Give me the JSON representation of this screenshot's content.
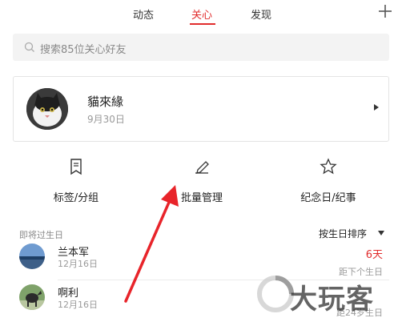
{
  "top_tabs": [
    {
      "label": "动态",
      "active": false
    },
    {
      "label": "关心",
      "active": true
    },
    {
      "label": "发现",
      "active": false
    }
  ],
  "search": {
    "placeholder": "搜索85位关心好友"
  },
  "featured": {
    "name": "貓來緣",
    "date": "9月30日"
  },
  "actions": [
    {
      "label": "标签/分组",
      "icon": "bookmark-icon"
    },
    {
      "label": "批量管理",
      "icon": "edit-pencil-icon"
    },
    {
      "label": "纪念日/纪事",
      "icon": "star-icon"
    }
  ],
  "section": {
    "title": "即将过生日",
    "sort_label": "按生日排序"
  },
  "list": [
    {
      "name": "兰本军",
      "date": "12月16日",
      "days": "6天",
      "sub": "距下个生日"
    },
    {
      "name": "啊利",
      "date": "12月16日",
      "days": "",
      "sub": "距24岁生日"
    }
  ],
  "watermark": {
    "text": "大玩客"
  },
  "colors": {
    "accent": "#e12c2c",
    "muted": "#9a9a9a",
    "search_bg": "#f3f3f3"
  }
}
